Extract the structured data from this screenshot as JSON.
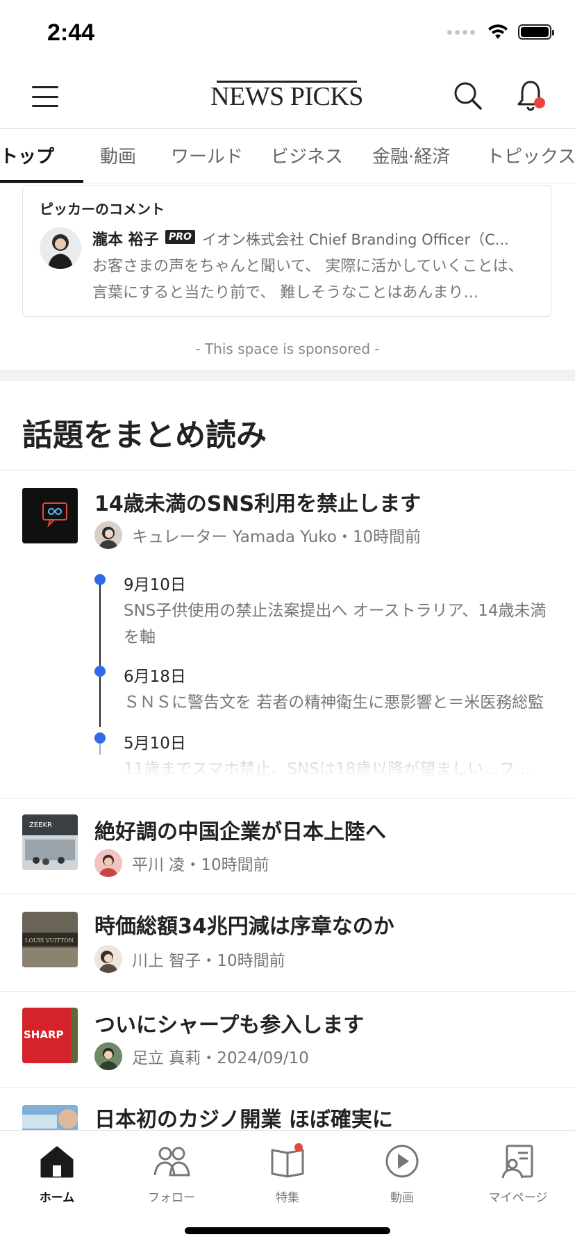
{
  "status_bar": {
    "time": "2:44"
  },
  "header": {
    "logo_text": "NEWS PICKS"
  },
  "tabs": [
    {
      "label": "トップ",
      "active": true
    },
    {
      "label": "動画"
    },
    {
      "label": "ワールド"
    },
    {
      "label": "ビジネス"
    },
    {
      "label": "金融·経済"
    },
    {
      "label": "トピックス"
    }
  ],
  "picker_comment": {
    "heading": "ピッカーのコメント",
    "name": "瀧本 裕子",
    "badge": "PRO",
    "affiliation": "イオン株式会社 Chief Branding Officer（C...",
    "body": "お客さまの声をちゃんと聞いて、 実際に活かしていくことは、 言葉にすると当たり前で、 難しそうなことはあんまり…"
  },
  "sponsored": "- This space is sponsored -",
  "section": {
    "title": "話題をまとめ読み"
  },
  "featured": {
    "title": "14歳未満のSNS利用を禁止します",
    "meta": "キュレーター Yamada Yuko・10時間前",
    "timeline": [
      {
        "date": "9月10日",
        "text": "SNS子供使用の禁止法案提出へ オーストラリア、14歳未満を軸"
      },
      {
        "date": "6月18日",
        "text": "ＳＮＳに警告文を 若者の精神衛生に悪影響と＝米医務総監"
      },
      {
        "date": "5月10日",
        "text": "11歳までスマホ禁止、SNSは18歳以降が望ましい...フ…"
      }
    ]
  },
  "articles": [
    {
      "title": "絶好調の中国企業が日本上陸へ",
      "meta": "平川 凌・10時間前",
      "thumb_text": "ZEEKR"
    },
    {
      "title": "時価総額34兆円減は序章なのか",
      "meta": "川上 智子・10時間前",
      "thumb_text": "LOUIS VUITTON"
    },
    {
      "title": "ついにシャープも参入します",
      "meta": "足立 真莉・2024/09/10",
      "thumb_text": "SHARP"
    },
    {
      "title": "日本初のカジノ開業 ほぼ確実に",
      "meta": "",
      "thumb_text": ""
    }
  ],
  "bottom_nav": [
    {
      "label": "ホーム",
      "icon": "home-icon",
      "active": true
    },
    {
      "label": "フォロー",
      "icon": "people-icon"
    },
    {
      "label": "特集",
      "icon": "book-icon"
    },
    {
      "label": "動画",
      "icon": "play-icon"
    },
    {
      "label": "マイページ",
      "icon": "profile-icon"
    }
  ],
  "colors": {
    "accent_blue": "#2f6be6",
    "notification_red": "#e5473e"
  }
}
